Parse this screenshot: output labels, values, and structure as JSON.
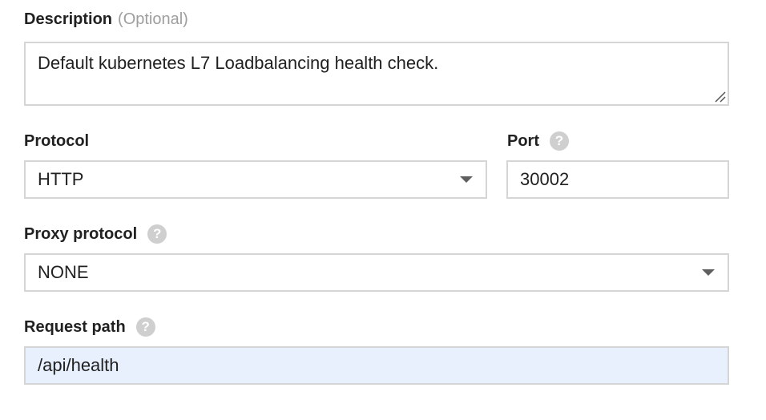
{
  "description": {
    "label": "Description",
    "optional": "(Optional)",
    "value": "Default kubernetes L7 Loadbalancing health check."
  },
  "protocol": {
    "label": "Protocol",
    "value": "HTTP"
  },
  "port": {
    "label": "Port",
    "value": "30002",
    "help_icon": "question-circle-icon"
  },
  "proxy_protocol": {
    "label": "Proxy protocol",
    "value": "NONE",
    "help_icon": "question-circle-icon"
  },
  "request_path": {
    "label": "Request path",
    "value": "/api/health",
    "help_icon": "question-circle-icon"
  },
  "colors": {
    "border": "#d5d5d5",
    "help_icon": "#cfcfcf",
    "autofill_bg": "#e8f0fe",
    "optional_text": "#9e9e9e"
  }
}
